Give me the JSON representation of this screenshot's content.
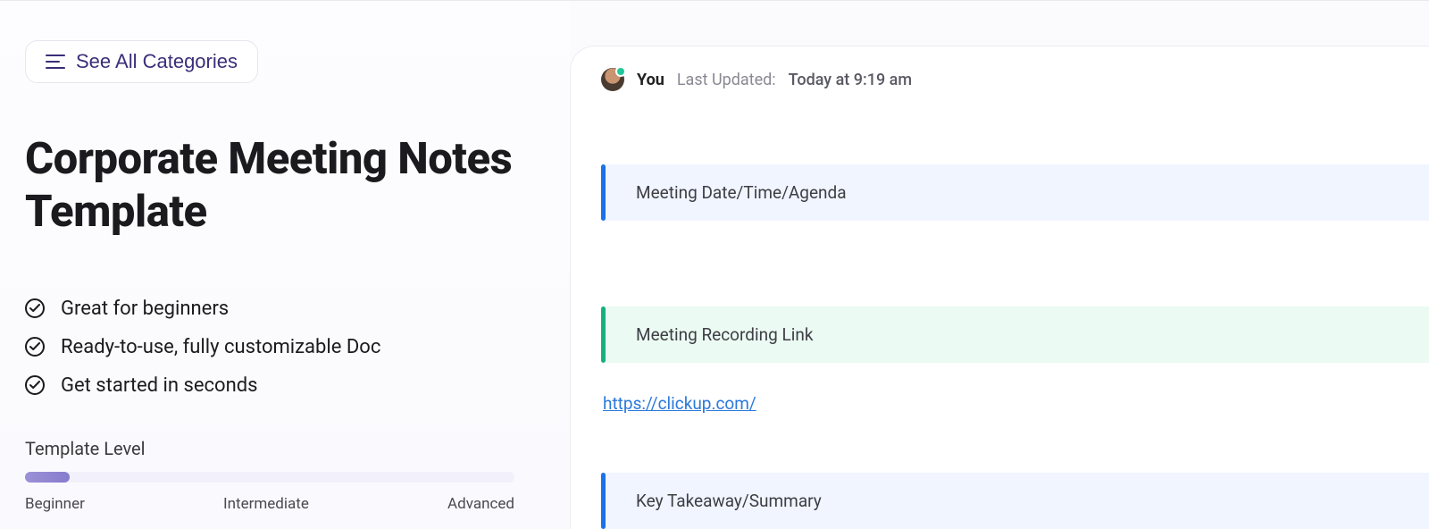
{
  "seeAll": {
    "label": "See All Categories"
  },
  "title": "Corporate Meeting Notes Template",
  "features": [
    "Great for beginners",
    "Ready-to-use, fully customizable Doc",
    "Get started in seconds"
  ],
  "levelHeading": "Template Level",
  "levels": {
    "beginner": "Beginner",
    "intermediate": "Intermediate",
    "advanced": "Advanced"
  },
  "doc": {
    "author": "You",
    "lastUpdatedLabel": "Last Updated:",
    "lastUpdatedValue": "Today at 9:19 am",
    "blocks": {
      "agenda": "Meeting Date/Time/Agenda",
      "recording": "Meeting Recording Link",
      "summary": "Key Takeaway/Summary"
    },
    "recordingLink": "https://clickup.com/"
  }
}
